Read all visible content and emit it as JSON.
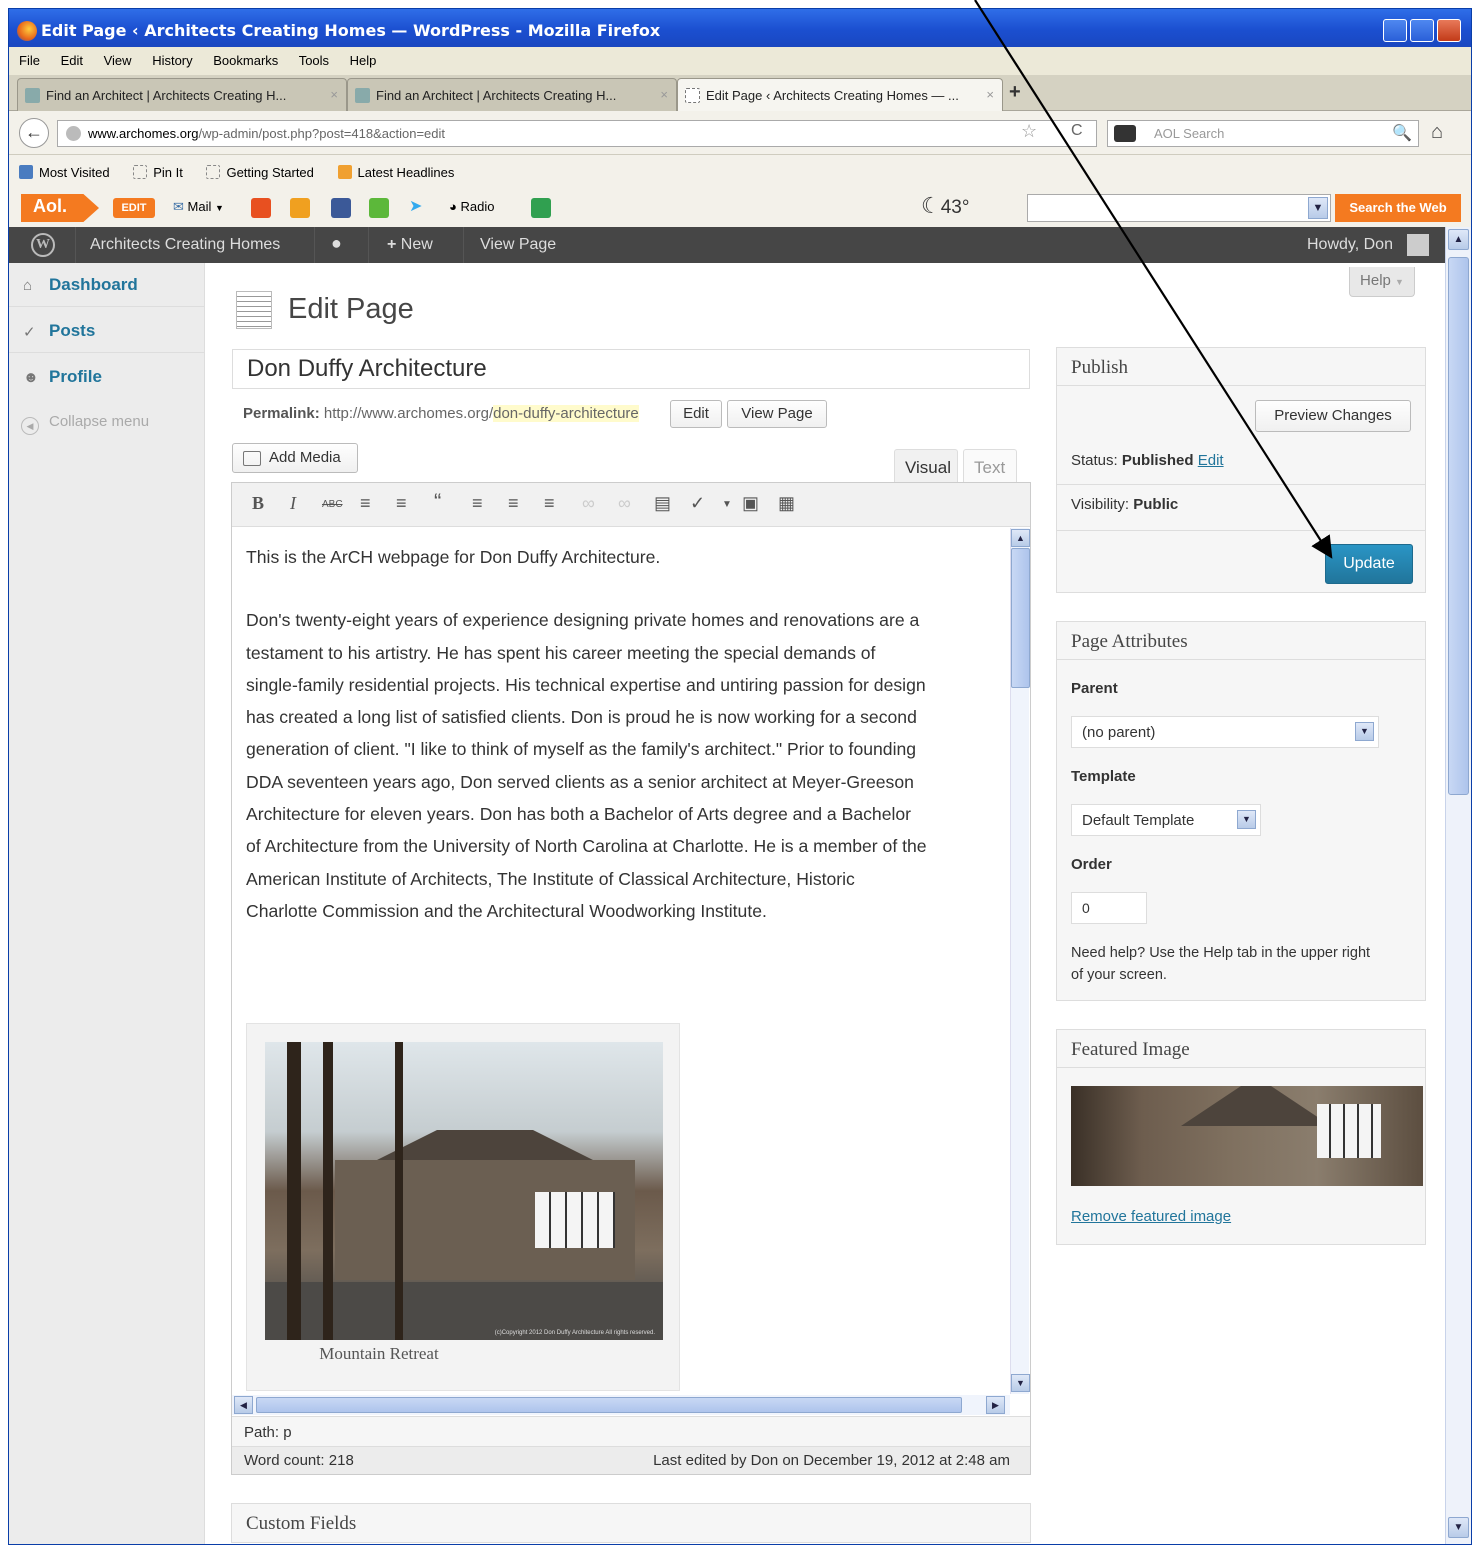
{
  "window": {
    "title": "Edit Page ‹ Architects Creating Homes — WordPress - Mozilla Firefox"
  },
  "menu": [
    "File",
    "Edit",
    "View",
    "History",
    "Bookmarks",
    "Tools",
    "Help"
  ],
  "tabs": [
    {
      "label": "Find an Architect | Architects Creating H...",
      "close": "×"
    },
    {
      "label": "Find an Architect | Architects Creating H...",
      "close": "×"
    },
    {
      "label": "Edit Page ‹ Architects Creating Homes — ...",
      "close": "×",
      "active": true
    }
  ],
  "newtab": "+",
  "nav": {
    "back": "←",
    "url_host": "www.archomes.org",
    "url_path": "/wp-admin/post.php?post=418&action=edit",
    "star": "☆",
    "reload": "C",
    "search_placeholder": "AOL Search",
    "search_icon": "magnifier-icon",
    "home": "⌂"
  },
  "bookmarks": [
    "Most Visited",
    "Pin It",
    "Getting Started",
    "Latest Headlines"
  ],
  "aolbar": {
    "logo": "Aol.",
    "edit": "EDIT",
    "mail": "Mail",
    "radio": "Radio",
    "temp": "43°",
    "search_btn": "Search the Web"
  },
  "adminbar": {
    "site": "Architects Creating Homes",
    "new": "New",
    "view": "View Page",
    "howdy": "Howdy, Don"
  },
  "sidebar": {
    "items": [
      "Dashboard",
      "Posts",
      "Profile"
    ],
    "collapse": "Collapse menu"
  },
  "page": {
    "help": "Help",
    "heading": "Edit Page",
    "title_value": "Don Duffy Architecture",
    "permalink_label": "Permalink:",
    "permalink_base": "http://www.archomes.org/",
    "permalink_slug": "don-duffy-architecture",
    "edit_btn": "Edit",
    "view_btn": "View Page",
    "add_media": "Add Media",
    "tab_visual": "Visual",
    "tab_text": "Text"
  },
  "editor": {
    "para1": "This is the ArCH webpage for Don Duffy Architecture.",
    "para2_lines": [
      "Don's twenty-eight years of experience designing private homes and renovations are a",
      "testament to his artistry. He has spent his career meeting the special demands of",
      "single-family residential projects. His technical expertise and untiring passion for design",
      "has created a long list of satisfied clients. Don is proud he is now working for a second",
      "generation of client. \"I like to think of myself as the family's architect.\" Prior to founding",
      "DDA seventeen years ago, Don served clients as a senior architect at Meyer-Greeson",
      "Architecture for eleven years. Don has both a Bachelor of Arts degree and a Bachelor",
      "of Architecture from the University of North Carolina at Charlotte. He is a member of the",
      "American Institute of Architects, The Institute of Classical Architecture, Historic",
      "Charlotte Commission and the Architectural Woodworking Institute."
    ],
    "image_caption": "Mountain Retreat",
    "photo_copyright": "(c)Copyright 2012 Don Duffy Architecture All rights reserved.",
    "path": "Path: p",
    "word_count": "Word count: 218",
    "last_edited": "Last edited by Don on December 19, 2012 at 2:48 am"
  },
  "custom_fields": "Custom Fields",
  "publish": {
    "heading": "Publish",
    "preview": "Preview Changes",
    "status_label": "Status:",
    "status_value": "Published",
    "status_edit": "Edit",
    "visibility_label": "Visibility:",
    "visibility_value": "Public",
    "update": "Update"
  },
  "attributes": {
    "heading": "Page Attributes",
    "parent_label": "Parent",
    "parent_value": "(no parent)",
    "template_label": "Template",
    "template_value": "Default Template",
    "order_label": "Order",
    "order_value": "0",
    "help_text_1": "Need help? Use the Help tab in the upper right",
    "help_text_2": "of your screen."
  },
  "featured": {
    "heading": "Featured Image",
    "remove": "Remove featured image"
  },
  "colors": {
    "accent": "#21759b",
    "aol_orange": "#f47a20",
    "wp_bar": "#464646"
  }
}
